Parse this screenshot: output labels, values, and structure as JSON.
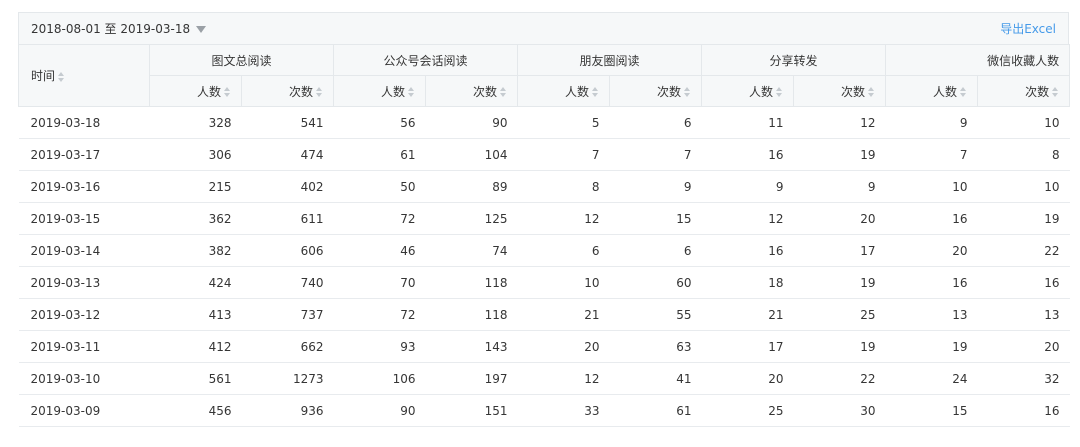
{
  "toolbar": {
    "date_range": "2018-08-01 至 2019-03-18",
    "export_label": "导出Excel"
  },
  "table": {
    "time_header": "时间",
    "groups": [
      "图文总阅读",
      "公众号会话阅读",
      "朋友圈阅读",
      "分享转发",
      "微信收藏人数"
    ],
    "sub_headers": [
      "人数",
      "次数"
    ],
    "rows": [
      [
        "2019-03-18",
        "328",
        "541",
        "56",
        "90",
        "5",
        "6",
        "11",
        "12",
        "9",
        "10"
      ],
      [
        "2019-03-17",
        "306",
        "474",
        "61",
        "104",
        "7",
        "7",
        "16",
        "19",
        "7",
        "8"
      ],
      [
        "2019-03-16",
        "215",
        "402",
        "50",
        "89",
        "8",
        "9",
        "9",
        "9",
        "10",
        "10"
      ],
      [
        "2019-03-15",
        "362",
        "611",
        "72",
        "125",
        "12",
        "15",
        "12",
        "20",
        "16",
        "19"
      ],
      [
        "2019-03-14",
        "382",
        "606",
        "46",
        "74",
        "6",
        "6",
        "16",
        "17",
        "20",
        "22"
      ],
      [
        "2019-03-13",
        "424",
        "740",
        "70",
        "118",
        "10",
        "60",
        "18",
        "19",
        "16",
        "16"
      ],
      [
        "2019-03-12",
        "413",
        "737",
        "72",
        "118",
        "21",
        "55",
        "21",
        "25",
        "13",
        "13"
      ],
      [
        "2019-03-11",
        "412",
        "662",
        "93",
        "143",
        "20",
        "63",
        "17",
        "19",
        "19",
        "20"
      ],
      [
        "2019-03-10",
        "561",
        "1273",
        "106",
        "197",
        "12",
        "41",
        "20",
        "22",
        "24",
        "32"
      ],
      [
        "2019-03-09",
        "456",
        "936",
        "90",
        "151",
        "33",
        "61",
        "25",
        "30",
        "15",
        "16"
      ]
    ]
  }
}
